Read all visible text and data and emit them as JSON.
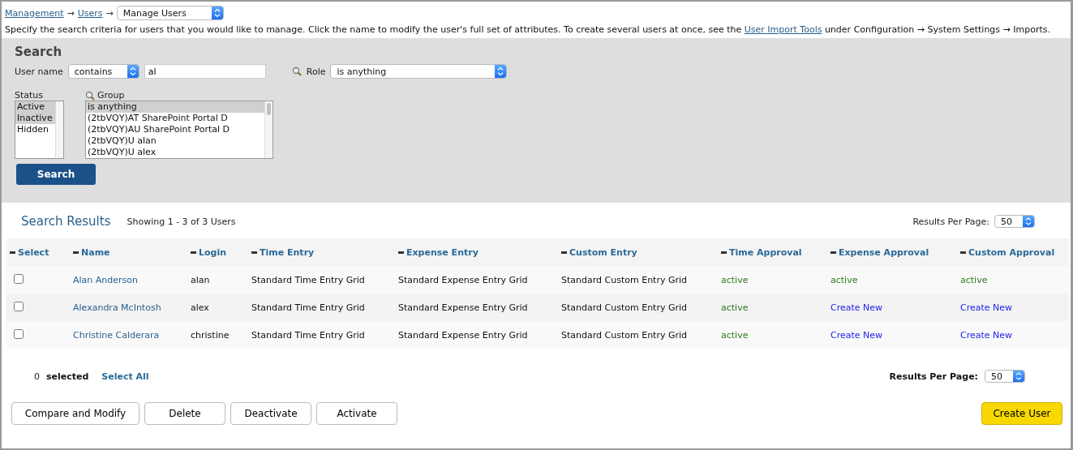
{
  "breadcrumb": {
    "links": [
      "Management",
      "Users"
    ],
    "separator": "→",
    "select": "Manage Users"
  },
  "intro": {
    "before": "Specify the search criteria for users that you would like to manage. Click the name to modify the user's full set of attributes. To create several users at once, see the",
    "link": "User Import Tools",
    "after": "under Configuration → System Settings → Imports."
  },
  "search": {
    "title": "Search",
    "username_label": "User name",
    "username_operator": "contains",
    "username_value": "al",
    "role_label": "Role",
    "role_value": "is anything",
    "status_label": "Status",
    "status_options": [
      {
        "label": "Active",
        "selected": true
      },
      {
        "label": "Inactive",
        "selected": true
      },
      {
        "label": "Hidden",
        "selected": false
      }
    ],
    "group_label": "Group",
    "group_options": [
      {
        "label": "is anything",
        "selected": true
      },
      {
        "label": "(2tbVQY)AT SharePoint Portal D",
        "selected": false
      },
      {
        "label": "(2tbVQY)AU SharePoint Portal D",
        "selected": false
      },
      {
        "label": "(2tbVQY)U alan",
        "selected": false
      },
      {
        "label": "(2tbVQY)U alex",
        "selected": false
      }
    ],
    "button": "Search"
  },
  "results": {
    "title": "Search Results",
    "showing": "Showing 1 - 3 of 3 Users",
    "per_page_label": "Results Per Page:",
    "per_page": "50",
    "columns": [
      "Select",
      "Name",
      "Login",
      "Time Entry",
      "Expense Entry",
      "Custom Entry",
      "Time Approval",
      "Expense Approval",
      "Custom Approval"
    ],
    "rows": [
      {
        "cells": [
          {
            "kind": "checkbox",
            "checked": false
          },
          {
            "kind": "link",
            "text": "Alan Anderson"
          },
          {
            "kind": "text",
            "text": "alan"
          },
          {
            "kind": "text",
            "text": "Standard Time Entry Grid"
          },
          {
            "kind": "text",
            "text": "Standard Expense Entry Grid"
          },
          {
            "kind": "text",
            "text": "Standard Custom Entry Grid"
          },
          {
            "kind": "status",
            "text": "active"
          },
          {
            "kind": "status",
            "text": "active"
          },
          {
            "kind": "status",
            "text": "active"
          }
        ]
      },
      {
        "cells": [
          {
            "kind": "checkbox",
            "checked": false
          },
          {
            "kind": "link",
            "text": "Alexandra McIntosh"
          },
          {
            "kind": "text",
            "text": "alex"
          },
          {
            "kind": "text",
            "text": "Standard Time Entry Grid"
          },
          {
            "kind": "text",
            "text": "Standard Expense Entry Grid"
          },
          {
            "kind": "text",
            "text": "Standard Custom Entry Grid"
          },
          {
            "kind": "status",
            "text": "active"
          },
          {
            "kind": "action",
            "text": "Create New"
          },
          {
            "kind": "action",
            "text": "Create New"
          }
        ]
      },
      {
        "cells": [
          {
            "kind": "checkbox",
            "checked": false
          },
          {
            "kind": "link",
            "text": "Christine Calderara"
          },
          {
            "kind": "text",
            "text": "christine"
          },
          {
            "kind": "text",
            "text": "Standard Time Entry Grid"
          },
          {
            "kind": "text",
            "text": "Standard Expense Entry Grid"
          },
          {
            "kind": "text",
            "text": "Standard Custom Entry Grid"
          },
          {
            "kind": "status",
            "text": "active"
          },
          {
            "kind": "action",
            "text": "Create New"
          },
          {
            "kind": "action",
            "text": "Create New"
          }
        ]
      }
    ],
    "selected_count": "0",
    "selected_label": "selected",
    "select_all": "Select All",
    "bottom_per_page_label": "Results Per Page:",
    "bottom_per_page": "50"
  },
  "actions": [
    "Compare and Modify",
    "Delete",
    "Deactivate",
    "Activate"
  ],
  "primary_action": "Create User"
}
